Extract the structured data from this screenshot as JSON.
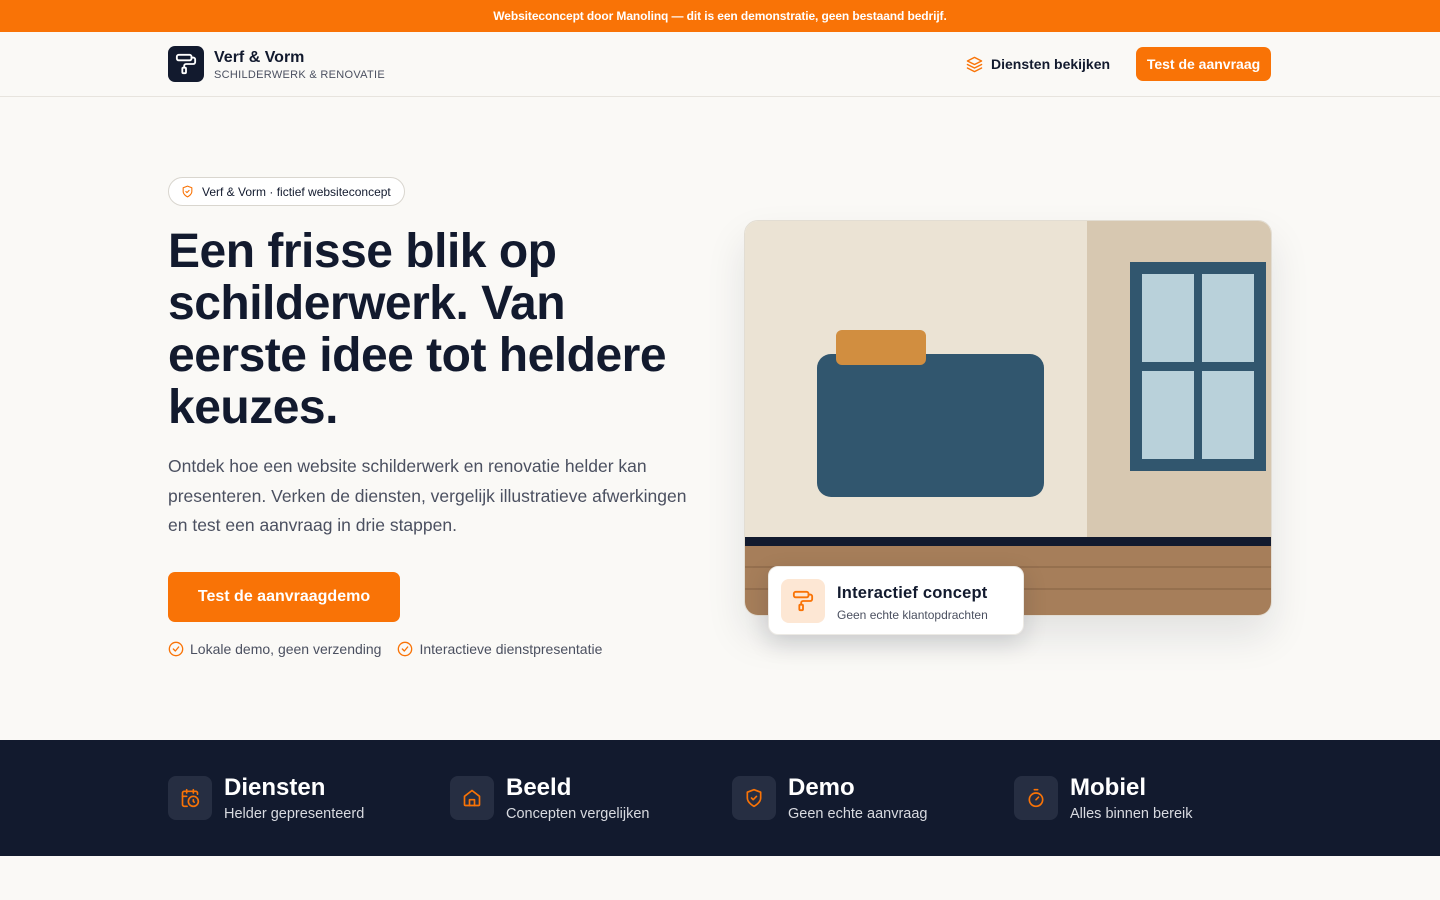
{
  "banner": {
    "text": "Websiteconcept door Manolinq — dit is een demonstratie, geen bestaand bedrijf."
  },
  "header": {
    "brand_name": "Verf & Vorm",
    "brand_tagline": "SCHILDERWERK & RENOVATIE",
    "nav_services": "Diensten bekijken",
    "nav_cta": "Test de aanvraag"
  },
  "hero": {
    "badge": "Verf & Vorm · fictief websiteconcept",
    "title": "Een frisse blik op schilderwerk. Van eerste idee tot heldere keuzes.",
    "text": "Ontdek hoe een website schilderwerk en renovatie helder kan presenteren. Verken de diensten, vergelijk illustratieve afwerkingen en test een aanvraag in drie stappen.",
    "cta": "Test de aanvraagdemo",
    "checks": [
      "Lokale demo, geen verzending",
      "Interactieve dienstpresentatie"
    ]
  },
  "illustration": {
    "card_title": "Interactief concept",
    "card_subtitle": "Geen echte klantopdrachten"
  },
  "stats": [
    {
      "icon": "calendar-clock-icon",
      "title": "Diensten",
      "subtitle": "Helder gepresenteerd"
    },
    {
      "icon": "house-icon",
      "title": "Beeld",
      "subtitle": "Concepten vergelijken"
    },
    {
      "icon": "shield-check-icon",
      "title": "Demo",
      "subtitle": "Geen echte aanvraag"
    },
    {
      "icon": "timer-icon",
      "title": "Mobiel",
      "subtitle": "Alles binnen bereik"
    }
  ],
  "colors": {
    "accent": "#f97306",
    "navy": "#121a2e",
    "background": "#faf9f6",
    "wall": "#ebe3d4",
    "sofa": "#31566e",
    "floor": "#a67e5a"
  }
}
